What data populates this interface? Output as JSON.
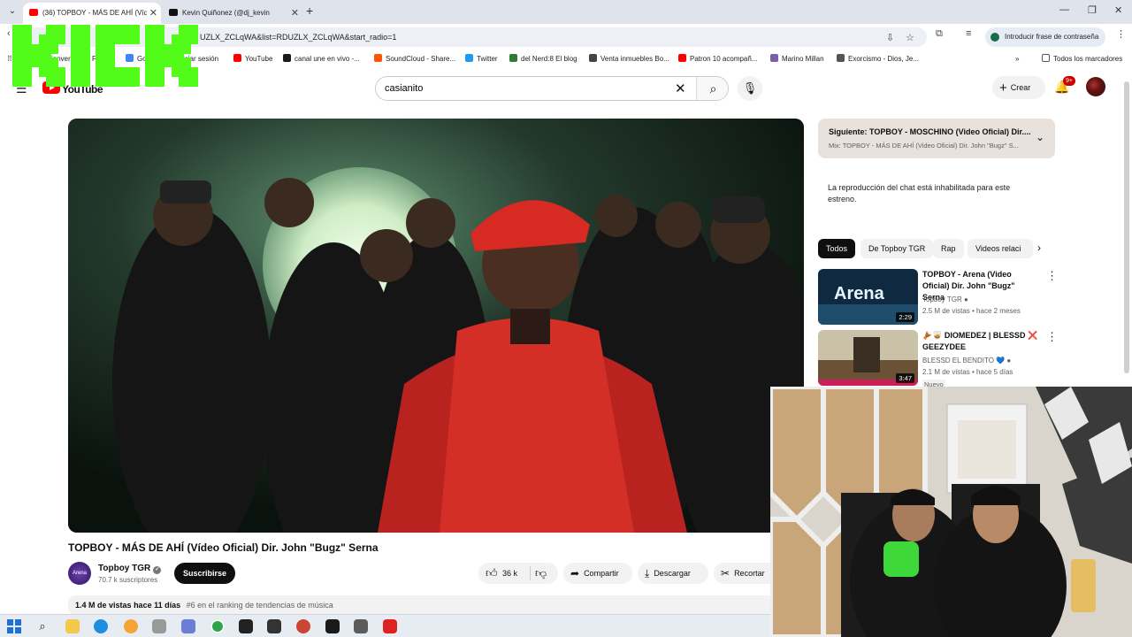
{
  "browser": {
    "tabs": [
      {
        "title": "(36) TOPBOY - MÁS DE AHÍ (Víd",
        "active": true,
        "favicon": "youtube-icon"
      },
      {
        "title": "Kevin Quiñonez (@dj_kevin",
        "active": false,
        "favicon": "tiktok-icon"
      }
    ],
    "url": "UZLX_ZCLqWA&list=RDUZLX_ZCLqWA&start_radio=1",
    "password_pill": "Introducir frase de contraseña",
    "bookmarks": [
      {
        "label": "ienver",
        "color": "#34a853"
      },
      {
        "label": "Fa",
        "color": "#1877f2"
      },
      {
        "label": "Go",
        "color": "#4285f4"
      },
      {
        "label": "iciar sesión",
        "color": "#888888"
      },
      {
        "label": "YouTube",
        "color": "#ff0000"
      },
      {
        "label": "canal une en vivo -...",
        "color": "#1a1a1a"
      },
      {
        "label": "SoundCloud - Share...",
        "color": "#ff5500"
      },
      {
        "label": "Twitter",
        "color": "#1d9bf0"
      },
      {
        "label": "del Nerd:8 El blog",
        "color": "#2e7d32"
      },
      {
        "label": "Venta inmuebles Bo...",
        "color": "#444444"
      },
      {
        "label": "Patron 10 acompañ...",
        "color": "#ff0000"
      },
      {
        "label": "Marino Millan",
        "color": "#7b5ea7"
      },
      {
        "label": "Exorcismo - Dios, Je...",
        "color": "#555555"
      }
    ],
    "bookmarks_all": "Todos los marcadores"
  },
  "youtube": {
    "logo_text": "YouTube",
    "search_value": "casianito",
    "create_label": "Crear",
    "notif_badge": "9+",
    "video": {
      "title": "TOPBOY - MÁS DE AHÍ (Vídeo Oficial) Dir. John \"Bugz\" Serna",
      "channel": "Topboy TGR",
      "channel_avatar_text": "Arena",
      "subscribers": "70.7 k suscriptores",
      "subscribe_label": "Suscribirse",
      "likes": "36 k",
      "share_label": "Compartir",
      "download_label": "Descargar",
      "clip_label": "Recortar",
      "views": "1.4 M de vistas",
      "age": "hace 11 días",
      "ranking": "#6 en el ranking de tendencias de música"
    },
    "up_next": {
      "title": "Siguiente: TOPBOY - MOSCHINO (Video Oficial) Dir....",
      "subtitle": "Mix: TOPBOY - MÁS DE AHÍ (Video Oficial) Dir. John \"Bugz\" S..."
    },
    "chat_disabled": "La reproducción del chat está inhabilitada para este estreno.",
    "chips": [
      "Todos",
      "De Topboy TGR",
      "Rap",
      "Videos relaci"
    ],
    "related": [
      {
        "title": "TOPBOY - Arena (Video Oficial) Dir. John \"Bugz\" Serna",
        "channel": "Topboy TGR",
        "meta": "2.5 M de vistas • hace 2 meses",
        "duration": "2:29",
        "thumb_text": "Arena",
        "badge": ""
      },
      {
        "title": "🪘🥃 DIOMEDEZ | BLESSD ❌ GEEZYDEE",
        "channel": "BLESSD EL BENDITO 💙",
        "meta": "2.1 M de vistas • hace 5 días",
        "duration": "3:47",
        "thumb_text": "",
        "badge": "Nuevo"
      }
    ]
  },
  "overlay": {
    "kick_logo_text": "KICK",
    "kick_color": "#53fc18"
  }
}
